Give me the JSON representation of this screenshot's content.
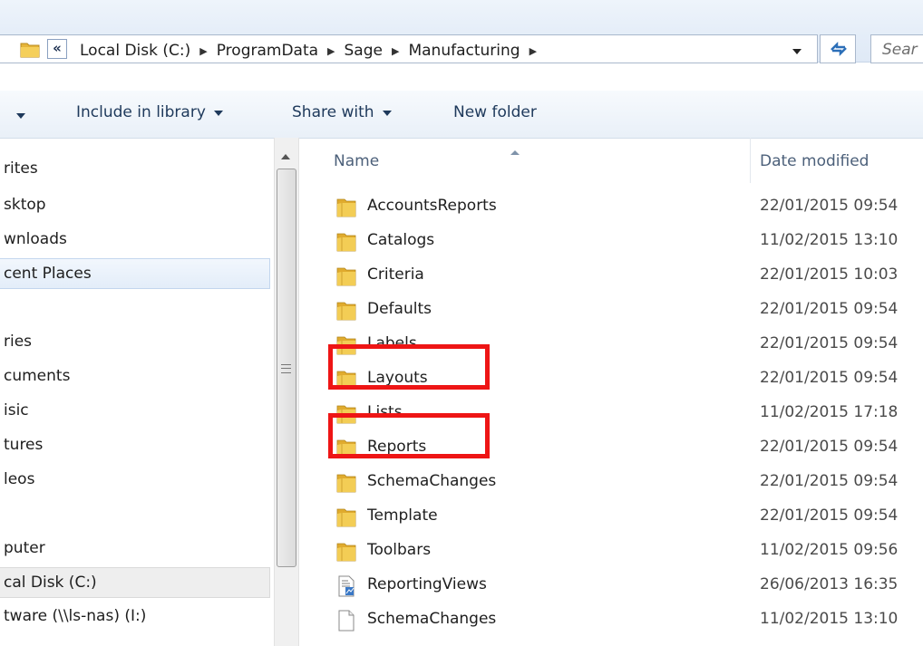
{
  "address_bar": {
    "crumbs": [
      "Local Disk (C:)",
      "ProgramData",
      "Sage",
      "Manufacturing"
    ],
    "search_placeholder": "Sear"
  },
  "toolbar": {
    "include_label": "Include in library",
    "share_label": "Share with",
    "new_folder_label": "New folder"
  },
  "nav": {
    "items": [
      {
        "label": "rites",
        "state": "normal"
      },
      {
        "label": "sktop",
        "state": "normal"
      },
      {
        "label": "wnloads",
        "state": "normal"
      },
      {
        "label": "cent Places",
        "state": "selected"
      },
      {
        "label": "ries",
        "state": "normal"
      },
      {
        "label": "cuments",
        "state": "normal"
      },
      {
        "label": "isic",
        "state": "normal"
      },
      {
        "label": "tures",
        "state": "normal"
      },
      {
        "label": "leos",
        "state": "normal"
      },
      {
        "label": "puter",
        "state": "normal"
      },
      {
        "label": "cal Disk (C:)",
        "state": "hover"
      },
      {
        "label": "tware (\\\\ls-nas) (I:)",
        "state": "normal"
      }
    ]
  },
  "columns": {
    "name": "Name",
    "date_modified": "Date modified"
  },
  "files": [
    {
      "name": "AccountsReports",
      "date": "22/01/2015 09:54",
      "type": "folder",
      "highlighted": false
    },
    {
      "name": "Catalogs",
      "date": "11/02/2015 13:10",
      "type": "folder",
      "highlighted": false
    },
    {
      "name": "Criteria",
      "date": "22/01/2015 10:03",
      "type": "folder",
      "highlighted": false
    },
    {
      "name": "Defaults",
      "date": "22/01/2015 09:54",
      "type": "folder",
      "highlighted": false
    },
    {
      "name": "Labels",
      "date": "22/01/2015 09:54",
      "type": "folder",
      "highlighted": false
    },
    {
      "name": "Layouts",
      "date": "22/01/2015 09:54",
      "type": "folder",
      "highlighted": true
    },
    {
      "name": "Lists",
      "date": "11/02/2015 17:18",
      "type": "folder",
      "highlighted": false
    },
    {
      "name": "Reports",
      "date": "22/01/2015 09:54",
      "type": "folder",
      "highlighted": true
    },
    {
      "name": "SchemaChanges",
      "date": "22/01/2015 09:54",
      "type": "folder",
      "highlighted": false
    },
    {
      "name": "Template",
      "date": "22/01/2015 09:54",
      "type": "folder",
      "highlighted": false
    },
    {
      "name": "Toolbars",
      "date": "11/02/2015 09:56",
      "type": "folder",
      "highlighted": false
    },
    {
      "name": "ReportingViews",
      "date": "26/06/2013 16:35",
      "type": "document",
      "highlighted": false
    },
    {
      "name": "SchemaChanges",
      "date": "11/02/2015 13:10",
      "type": "file",
      "highlighted": false
    }
  ],
  "colors": {
    "highlight_box": "#ee1515",
    "folder": "#e8b93c"
  }
}
